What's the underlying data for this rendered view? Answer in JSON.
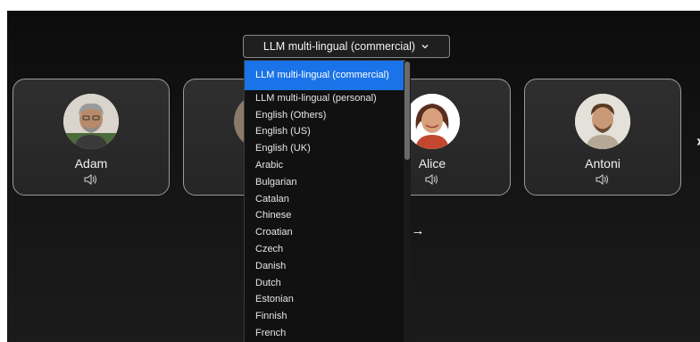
{
  "language_selector": {
    "label": "LLM multi-lingual (commercial)"
  },
  "dropdown": {
    "options": [
      "LLM multi-lingual (commercial)",
      "LLM multi-lingual (personal)",
      "English (Others)",
      "English (US)",
      "English (UK)",
      "Arabic",
      "Bulgarian",
      "Catalan",
      "Chinese",
      "Croatian",
      "Czech",
      "Danish",
      "Dutch",
      "Estonian",
      "Finnish",
      "French"
    ],
    "selected": "LLM multi-lingual (commercial)"
  },
  "voices": [
    {
      "name": "Adam",
      "icon": "speaker-icon"
    },
    {
      "name": "",
      "icon": "speaker-icon"
    },
    {
      "name": "Alice",
      "icon": "speaker-icon"
    },
    {
      "name": "Antoni",
      "icon": "speaker-icon"
    }
  ],
  "carousel": {
    "next_icon": "chevron-right-icon",
    "next_glyph": "›"
  },
  "preview_link": {
    "visible_text": "e →"
  },
  "colors": {
    "accent": "#1a73e8",
    "background": "#141414",
    "card": "#2a2a2a"
  }
}
